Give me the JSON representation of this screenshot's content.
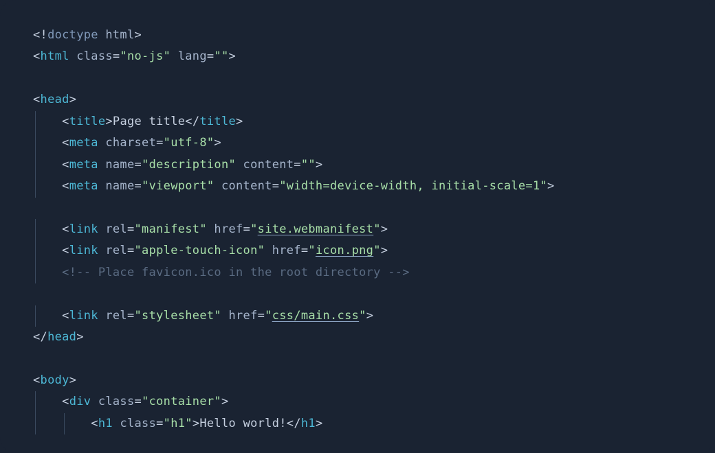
{
  "code": {
    "lines": [
      {
        "segments": [
          {
            "t": "<!",
            "c": "punct"
          },
          {
            "t": "doctype",
            "c": "doctype"
          },
          {
            "t": " html",
            "c": "attr"
          },
          {
            "t": ">",
            "c": "punct"
          }
        ]
      },
      {
        "segments": [
          {
            "t": "<",
            "c": "punct"
          },
          {
            "t": "html",
            "c": "tag"
          },
          {
            "t": " class",
            "c": "attr"
          },
          {
            "t": "=",
            "c": "punct"
          },
          {
            "t": "\"no-js\"",
            "c": "string"
          },
          {
            "t": " lang",
            "c": "attr"
          },
          {
            "t": "=",
            "c": "punct"
          },
          {
            "t": "\"\"",
            "c": "string"
          },
          {
            "t": ">",
            "c": "punct"
          }
        ]
      },
      {
        "segments": []
      },
      {
        "segments": [
          {
            "t": "<",
            "c": "punct"
          },
          {
            "t": "head",
            "c": "tag"
          },
          {
            "t": ">",
            "c": "punct"
          }
        ]
      },
      {
        "indent": 1,
        "guide": 1,
        "segments": [
          {
            "t": "    ",
            "c": "punct"
          },
          {
            "t": "<",
            "c": "punct"
          },
          {
            "t": "title",
            "c": "tag"
          },
          {
            "t": ">",
            "c": "punct"
          },
          {
            "t": "Page title",
            "c": "text"
          },
          {
            "t": "</",
            "c": "punct"
          },
          {
            "t": "title",
            "c": "tag"
          },
          {
            "t": ">",
            "c": "punct"
          }
        ]
      },
      {
        "indent": 1,
        "guide": 1,
        "segments": [
          {
            "t": "    ",
            "c": "punct"
          },
          {
            "t": "<",
            "c": "punct"
          },
          {
            "t": "meta",
            "c": "tag"
          },
          {
            "t": " charset",
            "c": "attr"
          },
          {
            "t": "=",
            "c": "punct"
          },
          {
            "t": "\"utf-8\"",
            "c": "string"
          },
          {
            "t": ">",
            "c": "punct"
          }
        ]
      },
      {
        "indent": 1,
        "guide": 1,
        "segments": [
          {
            "t": "    ",
            "c": "punct"
          },
          {
            "t": "<",
            "c": "punct"
          },
          {
            "t": "meta",
            "c": "tag"
          },
          {
            "t": " name",
            "c": "attr"
          },
          {
            "t": "=",
            "c": "punct"
          },
          {
            "t": "\"description\"",
            "c": "string"
          },
          {
            "t": " content",
            "c": "attr"
          },
          {
            "t": "=",
            "c": "punct"
          },
          {
            "t": "\"\"",
            "c": "string"
          },
          {
            "t": ">",
            "c": "punct"
          }
        ]
      },
      {
        "indent": 1,
        "guide": 1,
        "segments": [
          {
            "t": "    ",
            "c": "punct"
          },
          {
            "t": "<",
            "c": "punct"
          },
          {
            "t": "meta",
            "c": "tag"
          },
          {
            "t": " name",
            "c": "attr"
          },
          {
            "t": "=",
            "c": "punct"
          },
          {
            "t": "\"viewport\"",
            "c": "string"
          },
          {
            "t": " content",
            "c": "attr"
          },
          {
            "t": "=",
            "c": "punct"
          },
          {
            "t": "\"width=device-width, initial-scale=1\"",
            "c": "string"
          },
          {
            "t": ">",
            "c": "punct"
          }
        ]
      },
      {
        "segments": []
      },
      {
        "indent": 1,
        "guide": 1,
        "segments": [
          {
            "t": "    ",
            "c": "punct"
          },
          {
            "t": "<",
            "c": "punct"
          },
          {
            "t": "link",
            "c": "tag"
          },
          {
            "t": " rel",
            "c": "attr"
          },
          {
            "t": "=",
            "c": "punct"
          },
          {
            "t": "\"manifest\"",
            "c": "string"
          },
          {
            "t": " href",
            "c": "attr"
          },
          {
            "t": "=",
            "c": "punct"
          },
          {
            "t": "\"",
            "c": "string"
          },
          {
            "t": "site.webmanifest",
            "c": "string underline"
          },
          {
            "t": "\"",
            "c": "string"
          },
          {
            "t": ">",
            "c": "punct"
          }
        ]
      },
      {
        "indent": 1,
        "guide": 1,
        "segments": [
          {
            "t": "    ",
            "c": "punct"
          },
          {
            "t": "<",
            "c": "punct"
          },
          {
            "t": "link",
            "c": "tag"
          },
          {
            "t": " rel",
            "c": "attr"
          },
          {
            "t": "=",
            "c": "punct"
          },
          {
            "t": "\"apple-touch-icon\"",
            "c": "string"
          },
          {
            "t": " href",
            "c": "attr"
          },
          {
            "t": "=",
            "c": "punct"
          },
          {
            "t": "\"",
            "c": "string"
          },
          {
            "t": "icon.png",
            "c": "string underline"
          },
          {
            "t": "\"",
            "c": "string"
          },
          {
            "t": ">",
            "c": "punct"
          }
        ]
      },
      {
        "indent": 1,
        "guide": 1,
        "segments": [
          {
            "t": "    ",
            "c": "punct"
          },
          {
            "t": "<!-- Place favicon.ico in the root directory -->",
            "c": "comment"
          }
        ]
      },
      {
        "segments": []
      },
      {
        "indent": 1,
        "guide": 1,
        "segments": [
          {
            "t": "    ",
            "c": "punct"
          },
          {
            "t": "<",
            "c": "punct"
          },
          {
            "t": "link",
            "c": "tag"
          },
          {
            "t": " rel",
            "c": "attr"
          },
          {
            "t": "=",
            "c": "punct"
          },
          {
            "t": "\"stylesheet\"",
            "c": "string"
          },
          {
            "t": " href",
            "c": "attr"
          },
          {
            "t": "=",
            "c": "punct"
          },
          {
            "t": "\"",
            "c": "string"
          },
          {
            "t": "css/main.css",
            "c": "string underline"
          },
          {
            "t": "\"",
            "c": "string"
          },
          {
            "t": ">",
            "c": "punct"
          }
        ]
      },
      {
        "segments": [
          {
            "t": "</",
            "c": "punct"
          },
          {
            "t": "head",
            "c": "tag"
          },
          {
            "t": ">",
            "c": "punct"
          }
        ]
      },
      {
        "segments": []
      },
      {
        "segments": [
          {
            "t": "<",
            "c": "punct"
          },
          {
            "t": "body",
            "c": "tag"
          },
          {
            "t": ">",
            "c": "punct"
          }
        ]
      },
      {
        "indent": 1,
        "guide": 1,
        "segments": [
          {
            "t": "    ",
            "c": "punct"
          },
          {
            "t": "<",
            "c": "punct"
          },
          {
            "t": "div",
            "c": "tag"
          },
          {
            "t": " class",
            "c": "attr"
          },
          {
            "t": "=",
            "c": "punct"
          },
          {
            "t": "\"container\"",
            "c": "string"
          },
          {
            "t": ">",
            "c": "punct"
          }
        ]
      },
      {
        "indent": 2,
        "guide": 2,
        "segments": [
          {
            "t": "        ",
            "c": "punct"
          },
          {
            "t": "<",
            "c": "punct"
          },
          {
            "t": "h1",
            "c": "tag"
          },
          {
            "t": " class",
            "c": "attr"
          },
          {
            "t": "=",
            "c": "punct"
          },
          {
            "t": "\"h1\"",
            "c": "string"
          },
          {
            "t": ">",
            "c": "punct"
          },
          {
            "t": "Hello world!",
            "c": "text"
          },
          {
            "t": "</",
            "c": "punct"
          },
          {
            "t": "h1",
            "c": "tag"
          },
          {
            "t": ">",
            "c": "punct"
          }
        ]
      }
    ]
  }
}
